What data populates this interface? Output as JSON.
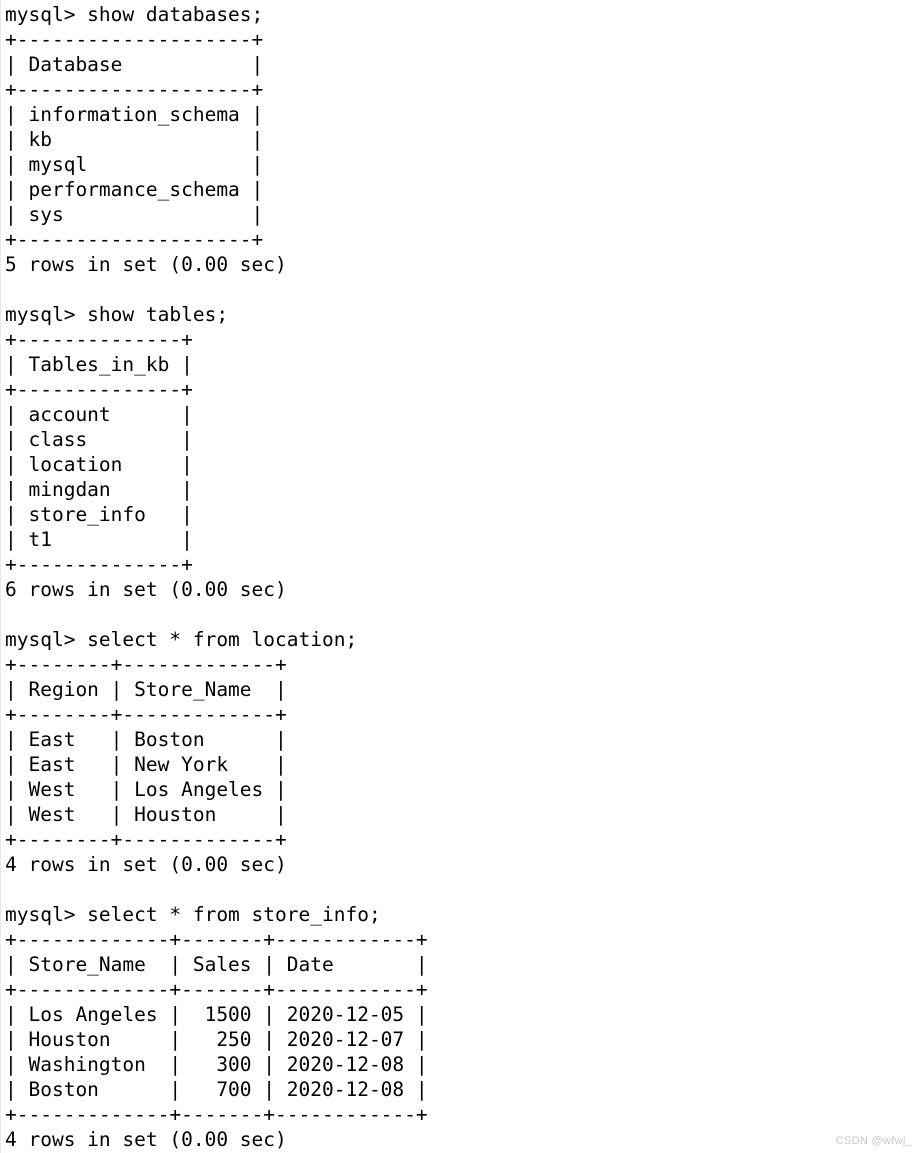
{
  "terminal": {
    "prompt": "mysql> ",
    "blocks": [
      {
        "command": "show databases;",
        "border": "+--------------------+",
        "header": "| Database           |",
        "rows": [
          "| information_schema |",
          "| kb                 |",
          "| mysql              |",
          "| performance_schema |",
          "| sys                |"
        ],
        "status": "5 rows in set (0.00 sec)",
        "table": {
          "columns": [
            "Database"
          ],
          "data": [
            [
              "information_schema"
            ],
            [
              "kb"
            ],
            [
              "mysql"
            ],
            [
              "performance_schema"
            ],
            [
              "sys"
            ]
          ],
          "row_count": 5,
          "elapsed": "0.00 sec"
        }
      },
      {
        "command": "show tables;",
        "border": "+--------------+",
        "header": "| Tables_in_kb |",
        "rows": [
          "| account      |",
          "| class        |",
          "| location     |",
          "| mingdan      |",
          "| store_info   |",
          "| t1           |"
        ],
        "status": "6 rows in set (0.00 sec)",
        "table": {
          "columns": [
            "Tables_in_kb"
          ],
          "data": [
            [
              "account"
            ],
            [
              "class"
            ],
            [
              "location"
            ],
            [
              "mingdan"
            ],
            [
              "store_info"
            ],
            [
              "t1"
            ]
          ],
          "row_count": 6,
          "elapsed": "0.00 sec"
        }
      },
      {
        "command": "select * from location;",
        "border": "+--------+-------------+",
        "header": "| Region | Store_Name  |",
        "rows": [
          "| East   | Boston      |",
          "| East   | New York    |",
          "| West   | Los Angeles |",
          "| West   | Houston     |"
        ],
        "status": "4 rows in set (0.00 sec)",
        "table": {
          "columns": [
            "Region",
            "Store_Name"
          ],
          "data": [
            [
              "East",
              "Boston"
            ],
            [
              "East",
              "New York"
            ],
            [
              "West",
              "Los Angeles"
            ],
            [
              "West",
              "Houston"
            ]
          ],
          "row_count": 4,
          "elapsed": "0.00 sec"
        }
      },
      {
        "command": "select * from store_info;",
        "border": "+-------------+-------+------------+",
        "header": "| Store_Name  | Sales | Date       |",
        "rows": [
          "| Los Angeles |  1500 | 2020-12-05 |",
          "| Houston     |   250 | 2020-12-07 |",
          "| Washington  |   300 | 2020-12-08 |",
          "| Boston      |   700 | 2020-12-08 |"
        ],
        "status": "4 rows in set (0.00 sec)",
        "table": {
          "columns": [
            "Store_Name",
            "Sales",
            "Date"
          ],
          "data": [
            [
              "Los Angeles",
              "1500",
              "2020-12-05"
            ],
            [
              "Houston",
              "250",
              "2020-12-07"
            ],
            [
              "Washington",
              "300",
              "2020-12-08"
            ],
            [
              "Boston",
              "700",
              "2020-12-08"
            ]
          ],
          "row_count": 4,
          "elapsed": "0.00 sec"
        }
      }
    ]
  },
  "watermark": {
    "text": "CSDN @wfwj_",
    "color": "#c8c8c8"
  },
  "colors": {
    "background": "#ffffff",
    "text": "#000000",
    "left_rule": "#e8e8e8"
  }
}
